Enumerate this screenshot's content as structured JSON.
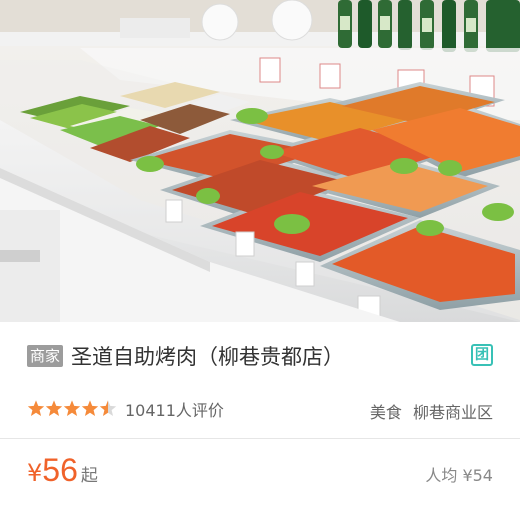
{
  "listing": {
    "merchant_badge": "商家",
    "shop_name": "圣道自助烤肉（柳巷贵都店）",
    "group_icon_label": "团",
    "rating": {
      "stars": 4.5,
      "max_stars": 5
    },
    "review_count": "10411人评价",
    "category": "美食",
    "district": "柳巷商业区",
    "price": {
      "currency": "¥",
      "amount": "56",
      "suffix": "起"
    },
    "average_price": "人均 ¥54"
  },
  "colors": {
    "accent_price": "#f0622a",
    "star_filled": "#f58a3a",
    "star_empty": "#d9d9d9",
    "group_icon": "#38c1b6",
    "merchant_badge_bg": "#9c9c9c"
  }
}
